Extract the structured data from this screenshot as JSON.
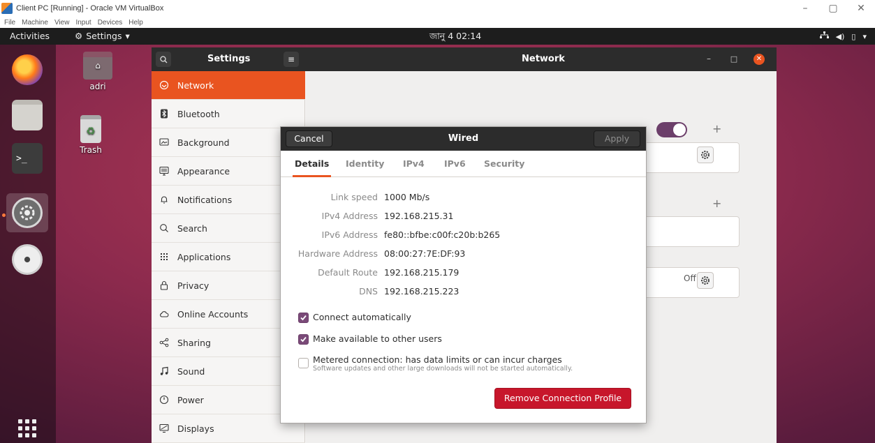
{
  "host": {
    "title": "Client PC [Running] - Oracle VM VirtualBox",
    "menu": [
      "File",
      "Machine",
      "View",
      "Input",
      "Devices",
      "Help"
    ],
    "controls": {
      "minimize": "–",
      "restore": "▢",
      "close": "✕"
    }
  },
  "topbar": {
    "activities": "Activities",
    "app_menu": "Settings",
    "clock": "জানু 4  02:14"
  },
  "desktop": {
    "home_label": "adri",
    "trash_label": "Trash"
  },
  "settings": {
    "title": "Settings",
    "page_title": "Network",
    "sidebar": [
      {
        "label": "Network",
        "icon": "network-icon"
      },
      {
        "label": "Bluetooth",
        "icon": "bluetooth-icon"
      },
      {
        "label": "Background",
        "icon": "background-icon"
      },
      {
        "label": "Appearance",
        "icon": "appearance-icon"
      },
      {
        "label": "Notifications",
        "icon": "bell-icon"
      },
      {
        "label": "Search",
        "icon": "search-icon"
      },
      {
        "label": "Applications",
        "icon": "grid-icon"
      },
      {
        "label": "Privacy",
        "icon": "lock-icon"
      },
      {
        "label": "Online Accounts",
        "icon": "cloud-icon"
      },
      {
        "label": "Sharing",
        "icon": "share-icon"
      },
      {
        "label": "Sound",
        "icon": "music-note-icon"
      },
      {
        "label": "Power",
        "icon": "power-icon"
      },
      {
        "label": "Displays",
        "icon": "display-icon"
      }
    ],
    "panel": {
      "off_label": "Off"
    }
  },
  "dialog": {
    "cancel": "Cancel",
    "title": "Wired",
    "apply": "Apply",
    "tabs": [
      "Details",
      "Identity",
      "IPv4",
      "IPv6",
      "Security"
    ],
    "details": [
      {
        "label": "Link speed",
        "value": "1000 Mb/s"
      },
      {
        "label": "IPv4 Address",
        "value": "192.168.215.31"
      },
      {
        "label": "IPv6 Address",
        "value": "fe80::bfbe:c00f:c20b:b265"
      },
      {
        "label": "Hardware Address",
        "value": "08:00:27:7E:DF:93"
      },
      {
        "label": "Default Route",
        "value": "192.168.215.179"
      },
      {
        "label": "DNS",
        "value": "192.168.215.223"
      }
    ],
    "connect_auto": "Connect automatically",
    "available_others": "Make available to other users",
    "metered": "Metered connection: has data limits or can incur charges",
    "metered_sub": "Software updates and other large downloads will not be started automatically.",
    "remove": "Remove Connection Profile"
  },
  "colors": {
    "accent": "#e95420",
    "toggle_on": "#6c3f6a",
    "destructive": "#c7162b"
  }
}
